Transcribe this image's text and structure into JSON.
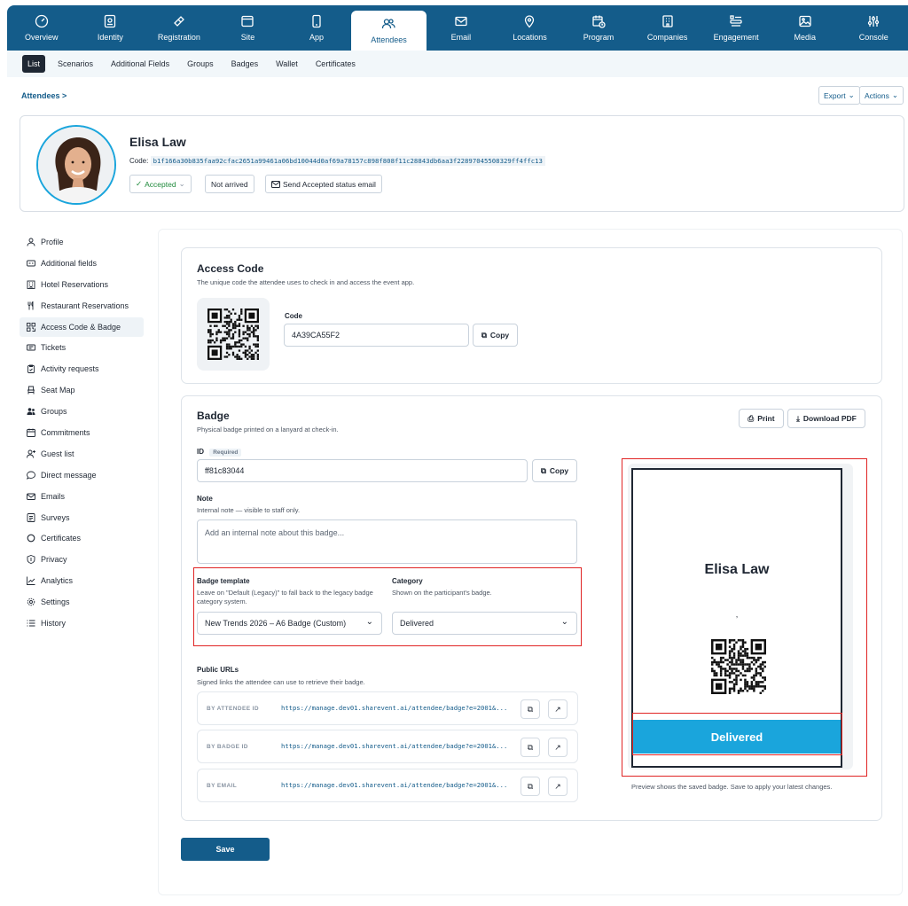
{
  "top_nav": [
    {
      "label": "Overview",
      "icon": "gauge-icon"
    },
    {
      "label": "Identity",
      "icon": "id-card-icon"
    },
    {
      "label": "Registration",
      "icon": "ticket-icon"
    },
    {
      "label": "Site",
      "icon": "browser-icon"
    },
    {
      "label": "App",
      "icon": "smartphone-icon"
    },
    {
      "label": "Attendees",
      "icon": "users-icon",
      "active": true
    },
    {
      "label": "Email",
      "icon": "email-icon"
    },
    {
      "label": "Locations",
      "icon": "map-pin-icon"
    },
    {
      "label": "Program",
      "icon": "calendar-clock-icon"
    },
    {
      "label": "Companies",
      "icon": "building-icon"
    },
    {
      "label": "Engagement",
      "icon": "engagement-icon"
    },
    {
      "label": "Media",
      "icon": "image-icon"
    },
    {
      "label": "Console",
      "icon": "sliders-icon"
    }
  ],
  "sub_nav": [
    "List",
    "Scenarios",
    "Additional Fields",
    "Groups",
    "Badges",
    "Wallet",
    "Certificates"
  ],
  "breadcrumb": "Attendees >",
  "export_label": "Export",
  "actions_label": "Actions",
  "attendee": {
    "name": "Elisa Law",
    "code_label": "Code:",
    "code_hash": "b1f166a30b835faa92cfac2651a99461a06bd10044d0af69a78157c898f808f11c28843db6aa3f22897045508329ff4ffc13",
    "status": "Accepted",
    "arrival": "Not arrived",
    "send_email": "Send Accepted status email"
  },
  "sidebar": [
    {
      "label": "Profile",
      "icon": "user-icon"
    },
    {
      "label": "Additional fields",
      "icon": "fields-icon"
    },
    {
      "label": "Hotel Reservations",
      "icon": "hotel-icon"
    },
    {
      "label": "Restaurant Reservations",
      "icon": "fork-knife-icon"
    },
    {
      "label": "Access Code & Badge",
      "icon": "qr-code-icon",
      "active": true
    },
    {
      "label": "Tickets",
      "icon": "ticket-icon"
    },
    {
      "label": "Activity requests",
      "icon": "clipboard-icon"
    },
    {
      "label": "Seat Map",
      "icon": "seat-icon"
    },
    {
      "label": "Groups",
      "icon": "group-icon"
    },
    {
      "label": "Commitments",
      "icon": "calendar-icon"
    },
    {
      "label": "Guest list",
      "icon": "user-plus-icon"
    },
    {
      "label": "Direct message",
      "icon": "chat-icon"
    },
    {
      "label": "Emails",
      "icon": "mail-icon"
    },
    {
      "label": "Surveys",
      "icon": "survey-icon"
    },
    {
      "label": "Certificates",
      "icon": "circle-icon"
    },
    {
      "label": "Privacy",
      "icon": "shield-icon"
    },
    {
      "label": "Analytics",
      "icon": "chart-icon"
    },
    {
      "label": "Settings",
      "icon": "gear-icon"
    },
    {
      "label": "History",
      "icon": "list-icon"
    }
  ],
  "access_code": {
    "title": "Access Code",
    "desc": "The unique code the attendee uses to check in and access the event app.",
    "code_label": "Code",
    "code_value": "4A39CA55F2",
    "copy": "Copy"
  },
  "badge": {
    "title": "Badge",
    "desc": "Physical badge printed on a lanyard at check-in.",
    "print": "Print",
    "download": "Download PDF",
    "id_label": "ID",
    "required": "Required",
    "id_value": "ff81c83044",
    "copy": "Copy",
    "note_label": "Note",
    "note_desc": "Internal note — visible to staff only.",
    "note_placeholder": "Add an internal note about this badge...",
    "template_label": "Badge template",
    "template_desc": "Leave on \"Default (Legacy)\" to fall back to the legacy badge category system.",
    "template_value": "New Trends 2026 – A6 Badge (Custom)",
    "category_label": "Category",
    "category_desc": "Shown on the participant's badge.",
    "category_value": "Delivered",
    "urls_label": "Public URLs",
    "urls_desc": "Signed links the attendee can use to retrieve their badge.",
    "urls": [
      {
        "kind": "BY ATTENDEE ID",
        "url": "https://manage.dev01.sharevent.ai/attendee/badge?e=2001&..."
      },
      {
        "kind": "BY BADGE ID",
        "url": "https://manage.dev01.sharevent.ai/attendee/badge?e=2001&..."
      },
      {
        "kind": "BY EMAIL",
        "url": "https://manage.dev01.sharevent.ai/attendee/badge?e=2001&..."
      }
    ],
    "preview_name": "Elisa Law",
    "preview_dot": ",",
    "preview_category": "Delivered",
    "preview_note": "Preview shows the saved badge. Save to apply your latest changes."
  },
  "save": "Save",
  "colors": {
    "primary": "#145c8a",
    "category_band": "#1aa5dc",
    "highlight": "#e02424",
    "accepted": "#1f8a3b"
  }
}
